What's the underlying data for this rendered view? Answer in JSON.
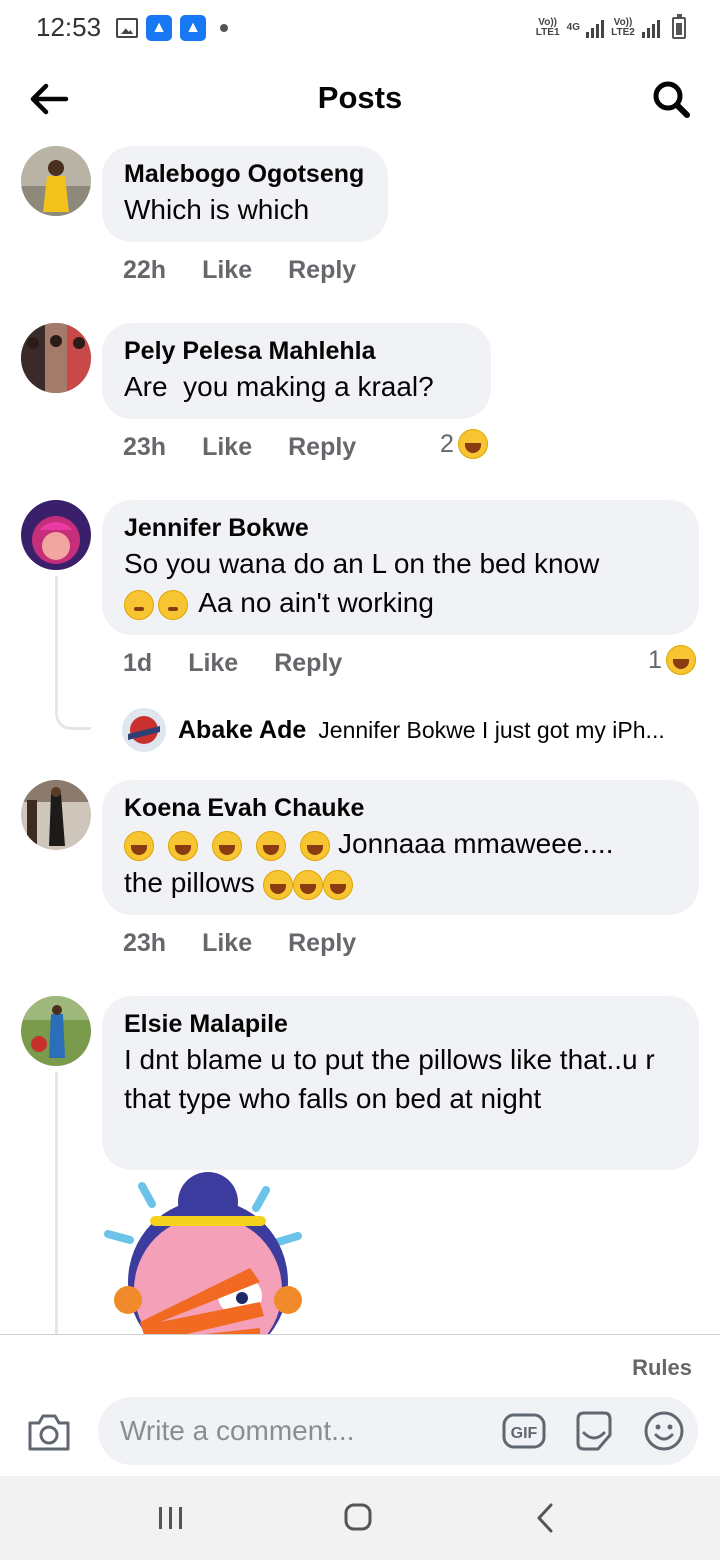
{
  "status_bar": {
    "time": "12:53",
    "network_1": "Vo)) LTE1",
    "network_type": "4G",
    "network_2": "Vo)) LTE2",
    "icons": [
      "gallery-icon",
      "rocket-icon",
      "rocket-icon",
      "dot-icon",
      "signal-icon",
      "battery-icon"
    ]
  },
  "header": {
    "title": "Posts",
    "back_icon": "arrow-left-icon",
    "search_icon": "search-icon"
  },
  "comments": [
    {
      "author": "Malebogo Ogotseng",
      "text": "Which is which",
      "time": "22h",
      "like": "Like",
      "reply": "Reply"
    },
    {
      "author": "Pely Pelesa Mahlehla",
      "text": "Are  you making a kraal?",
      "time": "23h",
      "like": "Like",
      "reply": "Reply",
      "reaction_count": "2",
      "reaction_icon": "laughing-emoji-icon"
    },
    {
      "author": "Jennifer Bokwe",
      "text_line1": "So you wana do an L on the bed know",
      "text_line2": "Aa no ain't working",
      "time": "1d",
      "like": "Like",
      "reply": "Reply",
      "reaction_count": "1",
      "reaction_icon": "laughing-emoji-icon",
      "reply_preview": {
        "author": "Abake Ade",
        "text": "Jennifer Bokwe I just got my iPh..."
      }
    },
    {
      "author": "Koena Evah Chauke",
      "text_line1": "Jonnaaa mmaweee....",
      "text_line2": "the pillows",
      "time": "23h",
      "like": "Like",
      "reply": "Reply"
    },
    {
      "author": "Elsie Malapile",
      "text": "I dnt blame u to put the  pillows like that..u r that type who falls on bed at night"
    }
  ],
  "composer": {
    "rules": "Rules",
    "placeholder": "Write a comment...",
    "gif_label": "GIF"
  },
  "colors": {
    "bubble": "#f0f2f5",
    "meta_text": "#65676b",
    "brand_blue": "#1877f2"
  }
}
